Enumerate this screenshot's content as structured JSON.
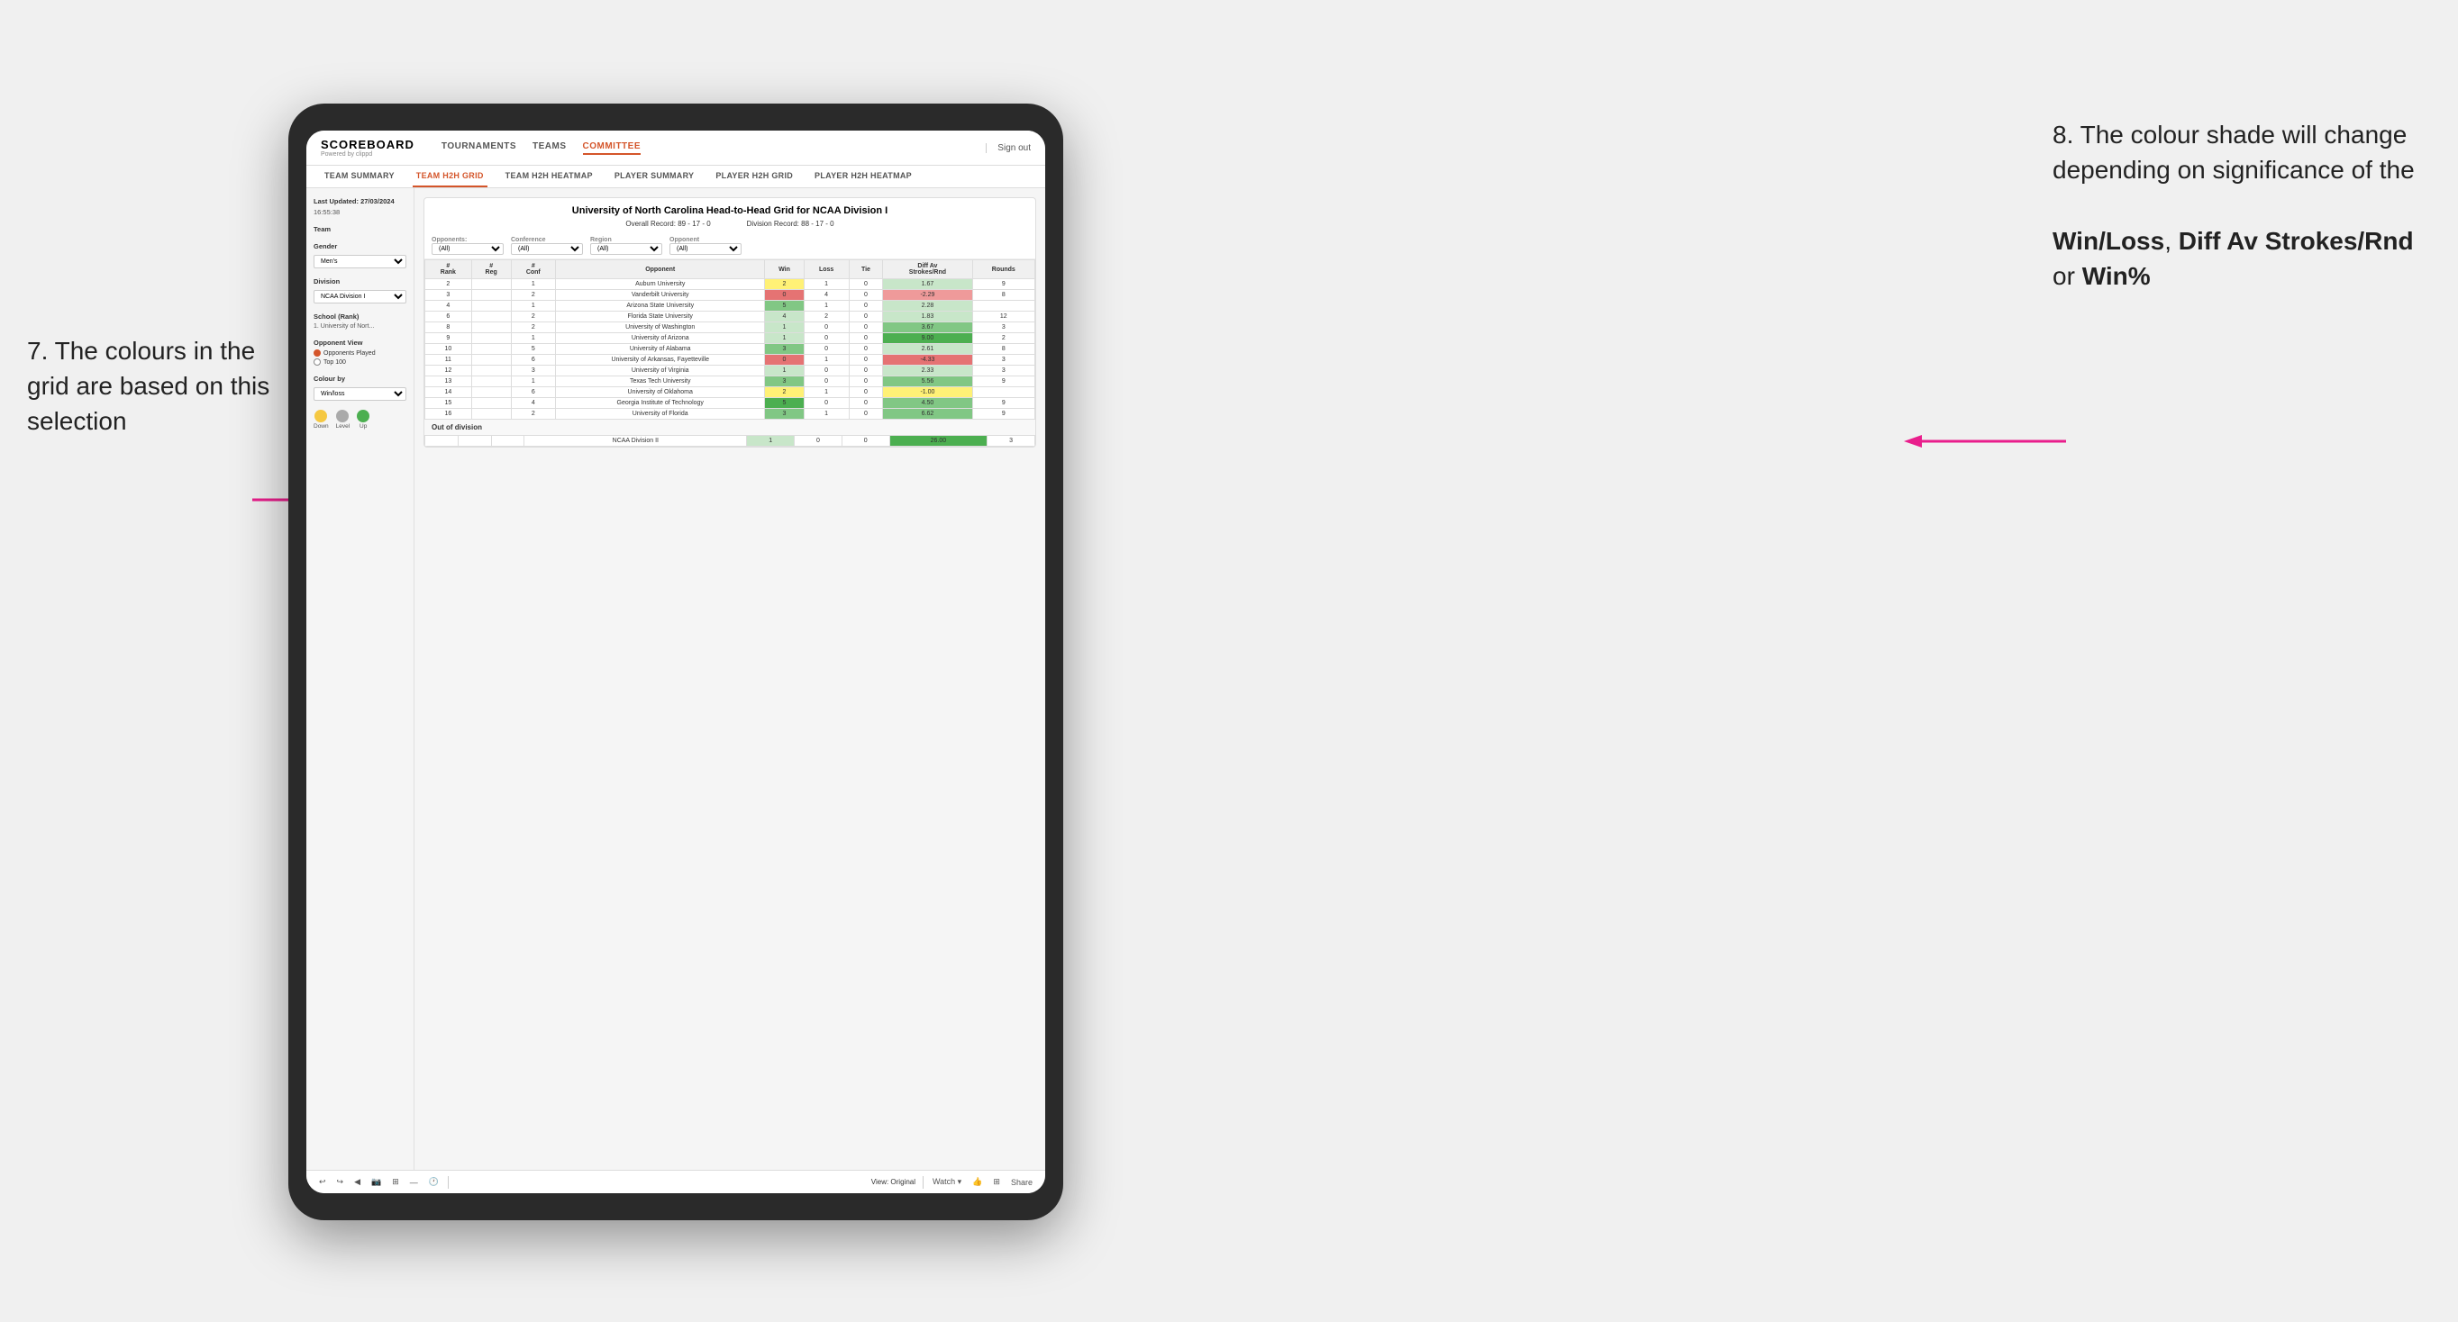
{
  "annotations": {
    "left_title": "7. The colours in the grid are based on this selection",
    "right_title": "8. The colour shade will change depending on significance of the",
    "right_bold1": "Win/Loss",
    "right_comma": ", ",
    "right_bold2": "Diff Av Strokes/Rnd",
    "right_or": " or ",
    "right_bold3": "Win%"
  },
  "header": {
    "logo": "SCOREBOARD",
    "logo_sub": "Powered by clippd",
    "nav": [
      "TOURNAMENTS",
      "TEAMS",
      "COMMITTEE"
    ],
    "active_nav": "COMMITTEE",
    "sign_out": "Sign out"
  },
  "sub_nav": {
    "items": [
      "TEAM SUMMARY",
      "TEAM H2H GRID",
      "TEAM H2H HEATMAP",
      "PLAYER SUMMARY",
      "PLAYER H2H GRID",
      "PLAYER H2H HEATMAP"
    ],
    "active": "TEAM H2H GRID"
  },
  "sidebar": {
    "last_updated_label": "Last Updated: 27/03/2024",
    "last_updated_time": "16:55:38",
    "team_label": "Team",
    "gender_label": "Gender",
    "gender_value": "Men's",
    "division_label": "Division",
    "division_value": "NCAA Division I",
    "school_label": "School (Rank)",
    "school_value": "1. University of Nort...",
    "opponent_view_label": "Opponent View",
    "radio1": "Opponents Played",
    "radio2": "Top 100",
    "colour_by_label": "Colour by",
    "colour_by_value": "Win/loss",
    "legend": [
      {
        "color": "#f5c842",
        "label": "Down"
      },
      {
        "color": "#aaaaaa",
        "label": "Level"
      },
      {
        "color": "#4caf50",
        "label": "Up"
      }
    ]
  },
  "grid": {
    "title": "University of North Carolina Head-to-Head Grid for NCAA Division I",
    "overall_record_label": "Overall Record:",
    "overall_record": "89 - 17 - 0",
    "division_record_label": "Division Record:",
    "division_record": "88 - 17 - 0",
    "filters": {
      "opponents_label": "Opponents:",
      "opponents_value": "(All)",
      "conference_label": "Conference",
      "conference_value": "(All)",
      "region_label": "Region",
      "region_value": "(All)",
      "opponent_label": "Opponent",
      "opponent_value": "(All)"
    },
    "columns": [
      "#\nRank",
      "#\nReg",
      "#\nConf",
      "Opponent",
      "Win",
      "Loss",
      "Tie",
      "Diff Av\nStrokes/Rnd",
      "Rounds"
    ],
    "rows": [
      {
        "rank": "2",
        "reg": "",
        "conf": "1",
        "opponent": "Auburn University",
        "win": "2",
        "loss": "1",
        "tie": "0",
        "diff": "1.67",
        "rounds": "9",
        "win_color": "cell-yellow",
        "diff_color": "cell-green-light"
      },
      {
        "rank": "3",
        "reg": "",
        "conf": "2",
        "opponent": "Vanderbilt University",
        "win": "0",
        "loss": "4",
        "tie": "0",
        "diff": "-2.29",
        "rounds": "8",
        "win_color": "cell-red-mid",
        "diff_color": "cell-red-light"
      },
      {
        "rank": "4",
        "reg": "",
        "conf": "1",
        "opponent": "Arizona State University",
        "win": "5",
        "loss": "1",
        "tie": "0",
        "diff": "2.28",
        "rounds": "",
        "win_color": "cell-green-mid",
        "diff_color": "cell-green-light"
      },
      {
        "rank": "6",
        "reg": "",
        "conf": "2",
        "opponent": "Florida State University",
        "win": "4",
        "loss": "2",
        "tie": "0",
        "diff": "1.83",
        "rounds": "12",
        "win_color": "cell-green-light",
        "diff_color": "cell-green-light"
      },
      {
        "rank": "8",
        "reg": "",
        "conf": "2",
        "opponent": "University of Washington",
        "win": "1",
        "loss": "0",
        "tie": "0",
        "diff": "3.67",
        "rounds": "3",
        "win_color": "cell-green-light",
        "diff_color": "cell-green-mid"
      },
      {
        "rank": "9",
        "reg": "",
        "conf": "1",
        "opponent": "University of Arizona",
        "win": "1",
        "loss": "0",
        "tie": "0",
        "diff": "9.00",
        "rounds": "2",
        "win_color": "cell-green-light",
        "diff_color": "cell-green-dark"
      },
      {
        "rank": "10",
        "reg": "",
        "conf": "5",
        "opponent": "University of Alabama",
        "win": "3",
        "loss": "0",
        "tie": "0",
        "diff": "2.61",
        "rounds": "8",
        "win_color": "cell-green-mid",
        "diff_color": "cell-green-light"
      },
      {
        "rank": "11",
        "reg": "",
        "conf": "6",
        "opponent": "University of Arkansas, Fayetteville",
        "win": "0",
        "loss": "1",
        "tie": "0",
        "diff": "-4.33",
        "rounds": "3",
        "win_color": "cell-red-mid",
        "diff_color": "cell-red-mid"
      },
      {
        "rank": "12",
        "reg": "",
        "conf": "3",
        "opponent": "University of Virginia",
        "win": "1",
        "loss": "0",
        "tie": "0",
        "diff": "2.33",
        "rounds": "3",
        "win_color": "cell-green-light",
        "diff_color": "cell-green-light"
      },
      {
        "rank": "13",
        "reg": "",
        "conf": "1",
        "opponent": "Texas Tech University",
        "win": "3",
        "loss": "0",
        "tie": "0",
        "diff": "5.56",
        "rounds": "9",
        "win_color": "cell-green-mid",
        "diff_color": "cell-green-mid"
      },
      {
        "rank": "14",
        "reg": "",
        "conf": "6",
        "opponent": "University of Oklahoma",
        "win": "2",
        "loss": "1",
        "tie": "0",
        "diff": "-1.00",
        "rounds": "",
        "win_color": "cell-yellow",
        "diff_color": "cell-yellow"
      },
      {
        "rank": "15",
        "reg": "",
        "conf": "4",
        "opponent": "Georgia Institute of Technology",
        "win": "5",
        "loss": "0",
        "tie": "0",
        "diff": "4.50",
        "rounds": "9",
        "win_color": "cell-green-dark",
        "diff_color": "cell-green-mid"
      },
      {
        "rank": "16",
        "reg": "",
        "conf": "2",
        "opponent": "University of Florida",
        "win": "3",
        "loss": "1",
        "tie": "0",
        "diff": "6.62",
        "rounds": "9",
        "win_color": "cell-green-mid",
        "diff_color": "cell-green-mid"
      }
    ],
    "out_of_division_label": "Out of division",
    "out_of_division_rows": [
      {
        "label": "NCAA Division II",
        "win": "1",
        "loss": "0",
        "tie": "0",
        "diff": "26.00",
        "rounds": "3",
        "win_color": "cell-green-light",
        "diff_color": "cell-green-dark"
      }
    ]
  },
  "toolbar": {
    "view_label": "View: Original",
    "watch_label": "Watch ▾",
    "share_label": "Share"
  }
}
